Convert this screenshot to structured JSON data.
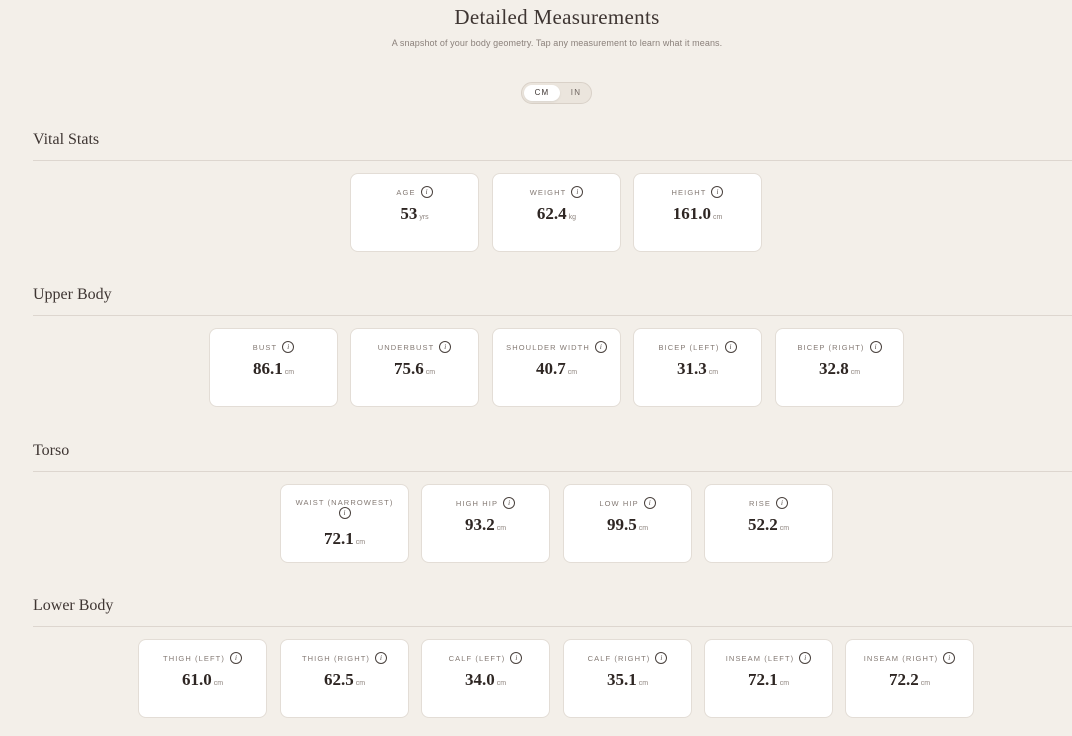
{
  "header": {
    "title": "Detailed Measurements",
    "subtitle": "A snapshot of your body geometry. Tap any measurement to learn what it means."
  },
  "unit_toggle": {
    "options": [
      "CM",
      "IN"
    ],
    "selected": "CM"
  },
  "colors": {
    "background": "#f3efe9",
    "card": "#ffffff",
    "accent_text": "#2e2623"
  },
  "icons": {
    "info": "info-icon"
  },
  "info_glyph": "i",
  "sections": [
    {
      "title": "Vital Stats",
      "cards": [
        {
          "label": "AGE",
          "value": "53",
          "unit": "yrs"
        },
        {
          "label": "WEIGHT",
          "value": "62.4",
          "unit": "kg"
        },
        {
          "label": "HEIGHT",
          "value": "161.0",
          "unit": "cm"
        }
      ]
    },
    {
      "title": "Upper Body",
      "cards": [
        {
          "label": "BUST",
          "value": "86.1",
          "unit": "cm"
        },
        {
          "label": "UNDERBUST",
          "value": "75.6",
          "unit": "cm"
        },
        {
          "label": "SHOULDER WIDTH",
          "value": "40.7",
          "unit": "cm"
        },
        {
          "label": "BICEP (LEFT)",
          "value": "31.3",
          "unit": "cm"
        },
        {
          "label": "BICEP (RIGHT)",
          "value": "32.8",
          "unit": "cm"
        }
      ]
    },
    {
      "title": "Torso",
      "cards": [
        {
          "label": "WAIST (NARROWEST)",
          "value": "72.1",
          "unit": "cm"
        },
        {
          "label": "HIGH HIP",
          "value": "93.2",
          "unit": "cm"
        },
        {
          "label": "LOW HIP",
          "value": "99.5",
          "unit": "cm"
        },
        {
          "label": "RISE",
          "value": "52.2",
          "unit": "cm"
        }
      ]
    },
    {
      "title": "Lower Body",
      "cards": [
        {
          "label": "THIGH (LEFT)",
          "value": "61.0",
          "unit": "cm"
        },
        {
          "label": "THIGH (RIGHT)",
          "value": "62.5",
          "unit": "cm"
        },
        {
          "label": "CALF (LEFT)",
          "value": "34.0",
          "unit": "cm"
        },
        {
          "label": "CALF (RIGHT)",
          "value": "35.1",
          "unit": "cm"
        },
        {
          "label": "INSEAM (LEFT)",
          "value": "72.1",
          "unit": "cm"
        },
        {
          "label": "INSEAM (RIGHT)",
          "value": "72.2",
          "unit": "cm"
        }
      ]
    }
  ]
}
